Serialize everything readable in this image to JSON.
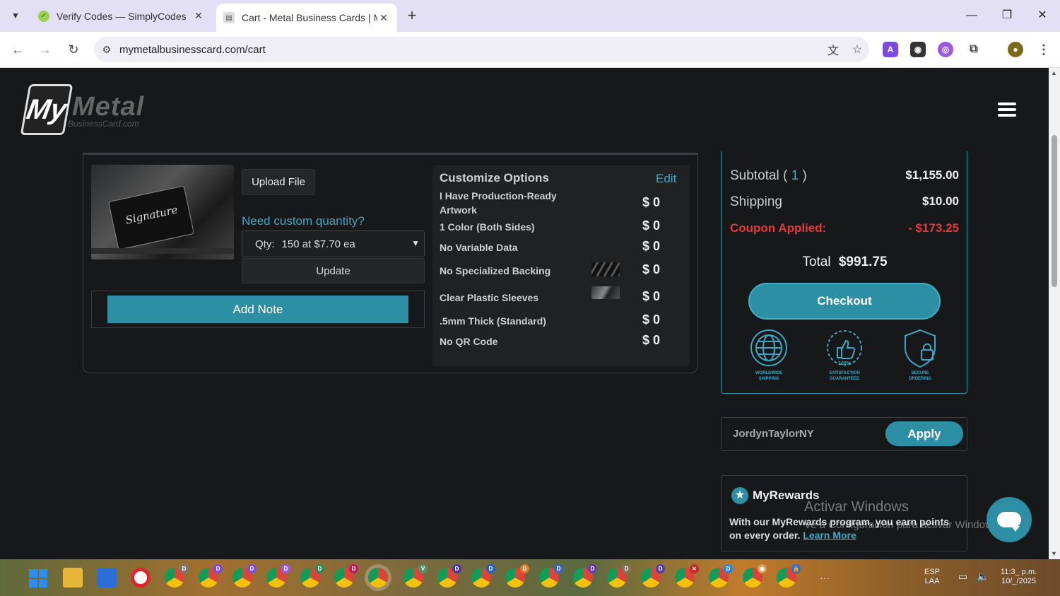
{
  "browser": {
    "tabs": [
      {
        "title": "Verify Codes — SimplyCodes",
        "active": false
      },
      {
        "title": "Cart - Metal Business Cards | M",
        "active": true
      }
    ],
    "url": "mymetalbusinesscard.com/cart"
  },
  "header": {
    "logo_my": "My",
    "logo_metal": "Metal",
    "logo_sub": "BusinessCard.com"
  },
  "cart_item": {
    "upload_label": "Upload File",
    "need_qty_label": "Need custom quantity?",
    "qty_label": "Qty:",
    "qty_value": "150 at $7.70 ea",
    "update_label": "Update",
    "add_note_label": "Add Note"
  },
  "options": {
    "heading": "Customize Options",
    "edit_label": "Edit",
    "rows": [
      {
        "name": "I Have Production-Ready Artwork",
        "price": "$ 0"
      },
      {
        "name": "1 Color (Both Sides)",
        "price": "$ 0"
      },
      {
        "name": "No Variable Data",
        "price": "$ 0"
      },
      {
        "name": "No Specialized Backing",
        "price": "$ 0"
      },
      {
        "name": "Clear Plastic Sleeves",
        "price": "$ 0"
      },
      {
        "name": ".5mm Thick (Standard)",
        "price": "$ 0"
      },
      {
        "name": "No QR Code",
        "price": "$ 0"
      }
    ]
  },
  "summary": {
    "subtotal_label": "Subtotal",
    "subtotal_count": "1",
    "subtotal_value": "$1,155.00",
    "shipping_label": "Shipping",
    "shipping_value": "$10.00",
    "coupon_label": "Coupon Applied:",
    "coupon_value": "- $173.25",
    "total_label": "Total",
    "total_value": "$991.75",
    "checkout_label": "Checkout",
    "badges": [
      {
        "line1": "WORLDWIDE",
        "line2": "SHIPPING"
      },
      {
        "line1": "SATISFACTION",
        "line2": "GUARANTEED"
      },
      {
        "line1": "SECURE",
        "line2": "ORDERING"
      }
    ]
  },
  "coupon": {
    "code": "JordynTaylorNY",
    "apply_label": "Apply"
  },
  "rewards": {
    "title": "MyRewards",
    "text": "With our MyRewards program, you earn points on every order.",
    "link": "Learn More"
  },
  "overlay": {
    "watermark_title": "Activar Windows",
    "watermark_sub": "Ve a Configuración para activar Windows."
  },
  "taskbar": {
    "lang": "ESP",
    "region": "LAA",
    "time": "11:3_ p.m.",
    "date": "10/_/2025"
  },
  "colors": {
    "accent": "#2d8fa3",
    "link": "#3fa7c3",
    "coupon": "#e23b3b",
    "background": "#171819"
  }
}
